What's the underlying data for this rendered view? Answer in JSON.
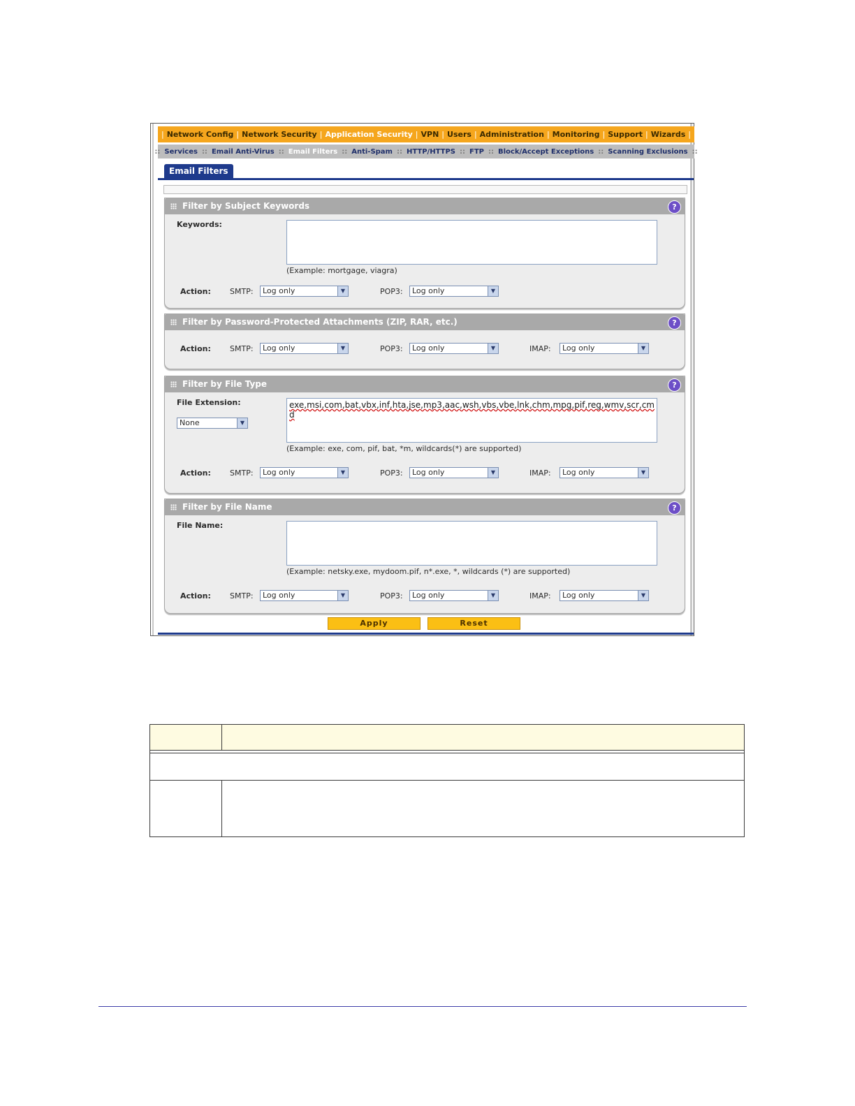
{
  "top_nav": [
    {
      "label": "Network Config",
      "active": false
    },
    {
      "label": "Network Security",
      "active": false
    },
    {
      "label": "Application Security",
      "active": true
    },
    {
      "label": "VPN",
      "active": false
    },
    {
      "label": "Users",
      "active": false
    },
    {
      "label": "Administration",
      "active": false
    },
    {
      "label": "Monitoring",
      "active": false
    },
    {
      "label": "Support",
      "active": false
    },
    {
      "label": "Wizards",
      "active": false
    }
  ],
  "sub_nav": [
    {
      "label": "Services",
      "active": false
    },
    {
      "label": "Email Anti-Virus",
      "active": false
    },
    {
      "label": "Email Filters",
      "active": true
    },
    {
      "label": "Anti-Spam",
      "active": false
    },
    {
      "label": "HTTP/HTTPS",
      "active": false
    },
    {
      "label": "FTP",
      "active": false
    },
    {
      "label": "Block/Accept Exceptions",
      "active": false
    },
    {
      "label": "Scanning Exclusions",
      "active": false
    }
  ],
  "tab_label": "Email Filters",
  "help_glyph": "?",
  "common": {
    "action_label": "Action:",
    "smtp_label": "SMTP:",
    "pop3_label": "POP3:",
    "imap_label": "IMAP:",
    "action_value": "Log only"
  },
  "subject_filter": {
    "title": "Filter by Subject Keywords",
    "keywords_label": "Keywords:",
    "keywords_value": "",
    "example": "(Example: mortgage, viagra)"
  },
  "password_filter": {
    "title": "Filter by Password-Protected Attachments (ZIP, RAR, etc.)"
  },
  "filetype_filter": {
    "title": "Filter by File Type",
    "extension_label": "File Extension:",
    "preset_value": "None",
    "extensions_value": "exe,msi,com,bat,vbx,inf,hta,jse,mp3,aac,wsh,vbs,vbe,lnk,chm,mpg,pif,reg,wmv,scr,cmd",
    "example": "(Example: exe, com, pif, bat, *m, wildcards(*) are supported)"
  },
  "filename_filter": {
    "title": "Filter by File Name",
    "name_label": "File Name:",
    "name_value": "",
    "example": "(Example: netsky.exe, mydoom.pif, n*.exe, *, wildcards (*) are supported)"
  },
  "buttons": {
    "apply": "Apply",
    "reset": "Reset"
  },
  "colors": {
    "top_nav_bg": "#f5a61d",
    "sub_nav_bg": "#bdbdbd",
    "tab_bg": "#1e3a8c",
    "panel_header_bg": "#a9a9a9",
    "help_icon": "#6d4fc7",
    "button_bg": "#fbbf14",
    "table_header_bg": "#fefbe1"
  }
}
